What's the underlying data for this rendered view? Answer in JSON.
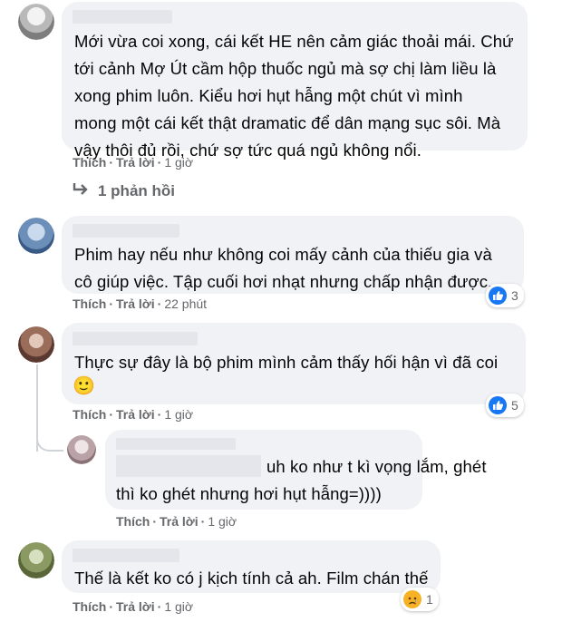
{
  "actions": {
    "like": "Thích",
    "reply": "Trả lời",
    "separator": "·"
  },
  "comments": [
    {
      "lines": [
        "Mới vừa coi xong, cái kết HE nên cảm giác thoải mái. Chứ",
        "tới cảnh Mợ Út cầm hộp thuốc ngủ mà sợ chị làm liều là",
        "xong phim luôn. Kiểu hơi hụt hẫng một chút vì mình",
        "mong một cái kết thật dramatic để dân mạng sục sôi. Mà",
        "vậy thôi đủ rồi, chứ sợ tức quá ngủ không nổi."
      ],
      "time": "1 giờ",
      "replies_label": "1 phản hồi"
    },
    {
      "lines": [
        "Phim hay nếu như không coi mấy cảnh của thiếu gia và",
        "cô giúp việc. Tập cuối hơi nhạt nhưng chấp nhận được."
      ],
      "time": "22 phút",
      "reaction": {
        "icon": "like-icon",
        "count": "3"
      }
    },
    {
      "lines": [
        "Thực sự đây là bộ phim mình cảm thấy hối hận vì đã coi"
      ],
      "emoji": "🙂",
      "time": "1 giờ",
      "reaction": {
        "icon": "like-icon",
        "count": "5"
      }
    },
    {
      "lines": [
        "uh ko như t kì vọng lắm, ghét",
        "thì ko ghét nhưng hơi hụt hẫng=))))"
      ],
      "time": "1 giờ",
      "is_reply": true
    },
    {
      "lines": [
        "Thế là kết ko có j kịch tính cả ah. Film chán thế"
      ],
      "time": "1 giờ",
      "reaction": {
        "icon": "sad-icon",
        "count": "1"
      }
    }
  ],
  "colors": {
    "bubble": "#f0f2f5",
    "meta_text": "#65676b",
    "like_blue": "#1877f2",
    "sad_yellow": "#f7b125"
  }
}
